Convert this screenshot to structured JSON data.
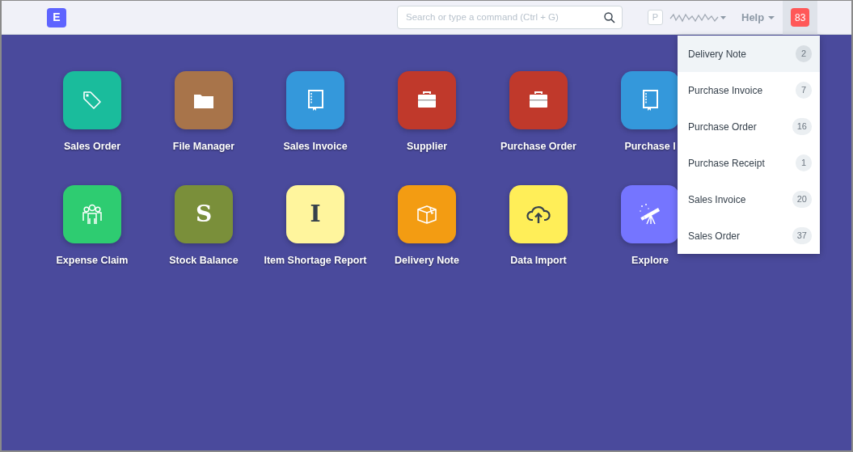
{
  "navbar": {
    "logo": "E",
    "search": {
      "placeholder": "Search or type a command (Ctrl + G)"
    },
    "avatar": "P",
    "help": "Help",
    "notifications": {
      "count": "83",
      "open": true
    }
  },
  "modules": [
    {
      "label": "Sales Order",
      "kind": "tag",
      "color": "#1abc9c"
    },
    {
      "label": "File Manager",
      "kind": "folder",
      "color": "#a8744a"
    },
    {
      "label": "Sales Invoice",
      "kind": "book",
      "color": "#3498db"
    },
    {
      "label": "Supplier",
      "kind": "briefcase",
      "color": "#c0392b"
    },
    {
      "label": "Purchase Order",
      "kind": "briefcase",
      "color": "#c0392b"
    },
    {
      "label": "Purchase I",
      "kind": "book",
      "color": "#3498db"
    },
    {
      "label": "Expense Claim",
      "kind": "people",
      "color": "#2ecc71"
    },
    {
      "label": "Stock Balance",
      "kind": "letter",
      "letter": "S",
      "color": "#7a8f3a"
    },
    {
      "label": "Item Shortage Report",
      "kind": "letter",
      "letter": "I",
      "color": "#fff59d"
    },
    {
      "label": "Delivery Note",
      "kind": "box",
      "color": "#f39c12"
    },
    {
      "label": "Data Import",
      "kind": "cloud",
      "color": "#ffee58"
    },
    {
      "label": "Explore",
      "kind": "telescope",
      "color": "#7575ff"
    }
  ],
  "dropdown": [
    {
      "label": "Delivery Note",
      "count": "2",
      "selected": true
    },
    {
      "label": "Purchase Invoice",
      "count": "7",
      "selected": false
    },
    {
      "label": "Purchase Order",
      "count": "16",
      "selected": false
    },
    {
      "label": "Purchase Receipt",
      "count": "1",
      "selected": false
    },
    {
      "label": "Sales Invoice",
      "count": "20",
      "selected": false
    },
    {
      "label": "Sales Order",
      "count": "37",
      "selected": false
    }
  ]
}
